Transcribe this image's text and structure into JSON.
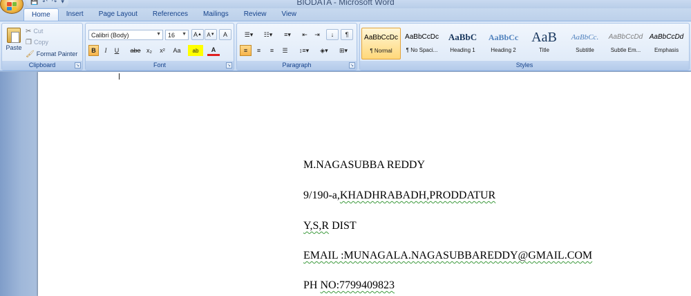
{
  "window": {
    "title": "BIODATA - Microsoft Word"
  },
  "quick_access": {
    "save": "💾",
    "undo": "↶",
    "redo": "↷",
    "more": "▾"
  },
  "tabs": [
    {
      "label": "Home",
      "active": true
    },
    {
      "label": "Insert"
    },
    {
      "label": "Page Layout"
    },
    {
      "label": "References"
    },
    {
      "label": "Mailings"
    },
    {
      "label": "Review"
    },
    {
      "label": "View"
    }
  ],
  "clipboard": {
    "label": "Clipboard",
    "paste": "Paste",
    "cut": "Cut",
    "copy": "Copy",
    "format_painter": "Format Painter"
  },
  "font": {
    "label": "Font",
    "family": "Calibri (Body)",
    "size": "16",
    "grow": "A",
    "shrink": "A",
    "clear": "A",
    "bold": "B",
    "italic": "I",
    "underline": "U",
    "strike": "abe",
    "subscript": "x₂",
    "superscript": "x²",
    "change_case": "Aa",
    "highlight": "ab",
    "color": "A"
  },
  "paragraph": {
    "label": "Paragraph",
    "show_marks": "¶",
    "sort": "↓"
  },
  "styles": {
    "label": "Styles",
    "items": [
      {
        "sample": "AaBbCcDc",
        "name": "¶ Normal",
        "selected": true
      },
      {
        "sample": "AaBbCcDc",
        "name": "¶ No Spaci..."
      },
      {
        "sample": "AaBbC",
        "name": "Heading 1"
      },
      {
        "sample": "AaBbCc",
        "name": "Heading 2"
      },
      {
        "sample": "AaB",
        "name": "Title"
      },
      {
        "sample": "AaBbCc.",
        "name": "Subtitle"
      },
      {
        "sample": "AaBbCcDd",
        "name": "Subtle Em..."
      },
      {
        "sample": "AaBbCcDd",
        "name": "Emphasis"
      }
    ]
  },
  "document": {
    "lines": {
      "name": " M.NAGASUBBA REDDY",
      "address_prefix": "9/190-a,",
      "address_main": "KHADHRABADH,PRODDATUR",
      "district_main": "Y,S,R",
      "district_suffix": " DIST",
      "email": "EMAIL :MUNAGALA.NAGASUBBAREDDY@GMAIL.COM",
      "phone_prefix": "PH ",
      "phone_main": "NO:7799409823"
    }
  },
  "colors": {
    "ribbon_text": "#15428b",
    "selected_style": "#ffd87a",
    "spell_squiggle": "#3c9a3c"
  }
}
